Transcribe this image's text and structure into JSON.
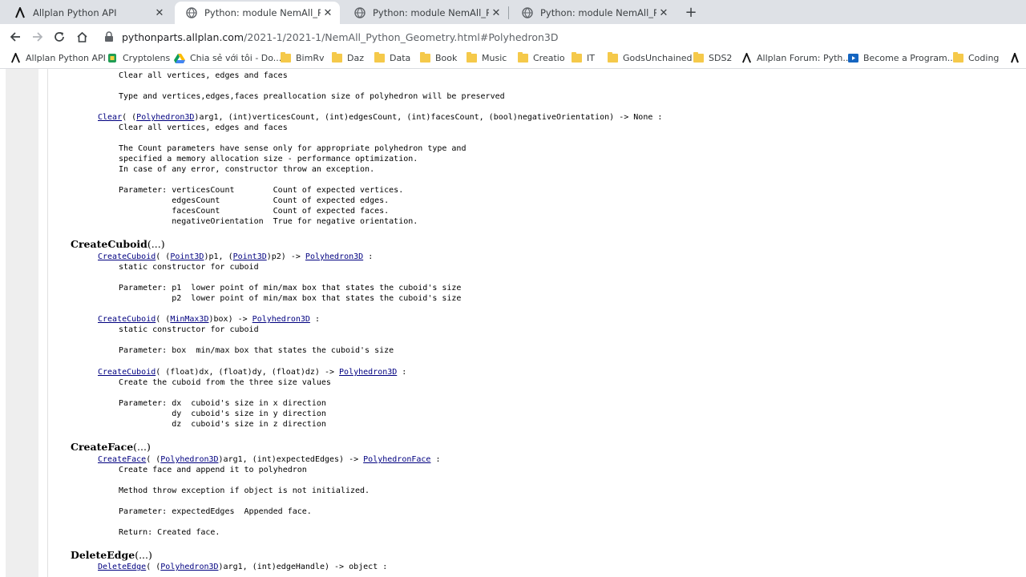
{
  "tabs": [
    {
      "title": "Allplan Python API",
      "icon": "allplan-logo-icon",
      "active": false
    },
    {
      "title": "Python: module NemAll_Python_",
      "icon": "globe-icon",
      "active": true
    },
    {
      "title": "Python: module NemAll_Python_",
      "icon": "globe-icon",
      "active": false
    },
    {
      "title": "Python: module NemAll_Python_",
      "icon": "globe-icon",
      "active": false
    }
  ],
  "toolbar": {
    "url_host": "pythonparts.allplan.com",
    "url_path": "/2021-1/2021-1/NemAll_Python_Geometry.html#Polyhedron3D"
  },
  "bookmarks": [
    {
      "label": "Allplan Python API",
      "icon": "allplan-logo-icon"
    },
    {
      "label": "Cryptolens",
      "icon": "cryptolens-icon"
    },
    {
      "label": "Chia sẻ với tôi - Do...",
      "icon": "google-drive-icon"
    },
    {
      "label": "BimRv",
      "icon": "folder-icon"
    },
    {
      "label": "Daz",
      "icon": "folder-icon"
    },
    {
      "label": "Data",
      "icon": "folder-icon"
    },
    {
      "label": "Book",
      "icon": "folder-icon"
    },
    {
      "label": "Music",
      "icon": "folder-icon"
    },
    {
      "label": "Creatio",
      "icon": "folder-icon"
    },
    {
      "label": "IT",
      "icon": "folder-icon"
    },
    {
      "label": "GodsUnchained",
      "icon": "folder-icon"
    },
    {
      "label": "SDS2",
      "icon": "folder-icon"
    },
    {
      "label": "Allplan Forum: Pyth...",
      "icon": "allplan-logo-icon"
    },
    {
      "label": "Become a Program...",
      "icon": "video-icon"
    },
    {
      "label": "Coding",
      "icon": "folder-icon"
    }
  ],
  "doc": {
    "l1": "Clear all vertices, edges and faces",
    "l2": "Type and vertices,edges,faces preallocation size of polyhedron will be preserved",
    "clear2": {
      "link": "Clear",
      "a": "( (",
      "t1": "Polyhedron3D",
      "rest": ")arg1, (int)verticesCount, (int)edgesCount, (int)facesCount, (bool)negativeOrientation) -> None :"
    },
    "l3": "Clear all vertices, edges and faces",
    "l4": "The Count parameters have sense only for appropriate polyhedron type and",
    "l5": "specified a memory allocation size - performance optimization.",
    "l6": "In case of any error, constructor throw an exception.",
    "p1": "Parameter: verticesCount        Count of expected vertices.",
    "p2": "           edgesCount           Count of expected edges.",
    "p3": "           facesCount           Count of expected faces.",
    "p4": "           negativeOrientation  True for negative orientation.",
    "createCuboid": {
      "name": "CreateCuboid",
      "args": "(...)"
    },
    "cc1": {
      "link": "CreateCuboid",
      "a": "( (",
      "t1": "Point3D",
      "b": ")p1, (",
      "t2": "Point3D",
      "c": ")p2) -> ",
      "ret": "Polyhedron3D",
      "d": " :"
    },
    "cc1a": "static constructor for cuboid",
    "cc1p1": "Parameter: p1  lower point of min/max box that states the cuboid's size",
    "cc1p2": "           p2  lower point of min/max box that states the cuboid's size",
    "cc2": {
      "link": "CreateCuboid",
      "a": "( (",
      "t1": "MinMax3D",
      "b": ")box) -> ",
      "ret": "Polyhedron3D",
      "d": " :"
    },
    "cc2a": "static constructor for cuboid",
    "cc2p": "Parameter: box  min/max box that states the cuboid's size",
    "cc3": {
      "link": "CreateCuboid",
      "rest": "( (float)dx, (float)dy, (float)dz) -> ",
      "ret": "Polyhedron3D",
      "d": " :"
    },
    "cc3a": "Create the cuboid from the three size values",
    "cc3p1": "Parameter: dx  cuboid's size in x direction",
    "cc3p2": "           dy  cuboid's size in y direction",
    "cc3p3": "           dz  cuboid's size in z direction",
    "createFace": {
      "name": "CreateFace",
      "args": "(...)"
    },
    "cf1": {
      "link": "CreateFace",
      "a": "( (",
      "t1": "Polyhedron3D",
      "b": ")arg1, (int)expectedEdges) -> ",
      "ret": "PolyhedronFace",
      "d": " :"
    },
    "cf1a": "Create face and append it to polyhedron",
    "cf1b": "Method throw exception if object is not initialized.",
    "cf1p": "Parameter: expectedEdges  Appended face.",
    "cf1r": "Return: Created face.",
    "deleteEdge": {
      "name": "DeleteEdge",
      "args": "(...)"
    },
    "de1": {
      "link": "DeleteEdge",
      "a": "( (",
      "t1": "Polyhedron3D",
      "rest": ")arg1, (int)edgeHandle) -> object :"
    }
  }
}
